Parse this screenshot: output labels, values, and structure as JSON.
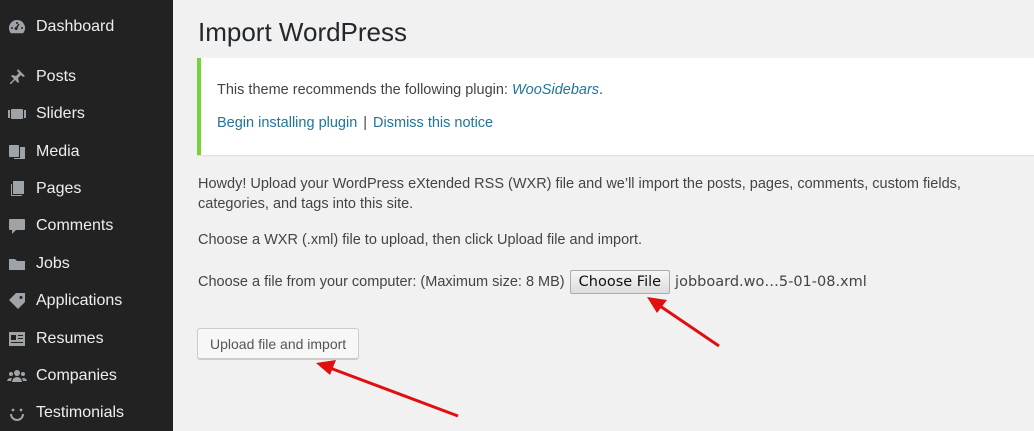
{
  "sidebar": {
    "items": [
      {
        "label": "Dashboard",
        "icon": "dashboard-icon"
      },
      {
        "label": "Posts",
        "icon": "pin-icon"
      },
      {
        "label": "Sliders",
        "icon": "slider-icon"
      },
      {
        "label": "Media",
        "icon": "media-icon"
      },
      {
        "label": "Pages",
        "icon": "pages-icon"
      },
      {
        "label": "Comments",
        "icon": "comment-icon"
      },
      {
        "label": "Jobs",
        "icon": "folder-icon"
      },
      {
        "label": "Applications",
        "icon": "tag-icon"
      },
      {
        "label": "Resumes",
        "icon": "id-card-icon"
      },
      {
        "label": "Companies",
        "icon": "group-icon"
      },
      {
        "label": "Testimonials",
        "icon": "smiley-icon"
      }
    ]
  },
  "page": {
    "title": "Import WordPress"
  },
  "notice": {
    "text_prefix": "This theme recommends the following plugin: ",
    "plugin_link": "WooSidebars",
    "text_suffix": ".",
    "begin_link": "Begin installing plugin",
    "separator": "|",
    "dismiss_link": "Dismiss this notice"
  },
  "content": {
    "intro": "Howdy! Upload your WordPress eXtended RSS (WXR) file and we’ll import the posts, pages, comments, custom fields, categories, and tags into this site.",
    "choose_hint": "Choose a WXR (.xml) file to upload, then click Upload file and import.",
    "file_label": "Choose a file from your computer: (Maximum size: 8 MB)",
    "choose_file_button": "Choose File",
    "file_name": "jobboard.wo…5-01-08.xml",
    "upload_button": "Upload file and import"
  },
  "colors": {
    "sidebar_bg": "#222222",
    "notice_border": "#7ad03a",
    "link": "#21759b",
    "arrow": "#e01010"
  }
}
